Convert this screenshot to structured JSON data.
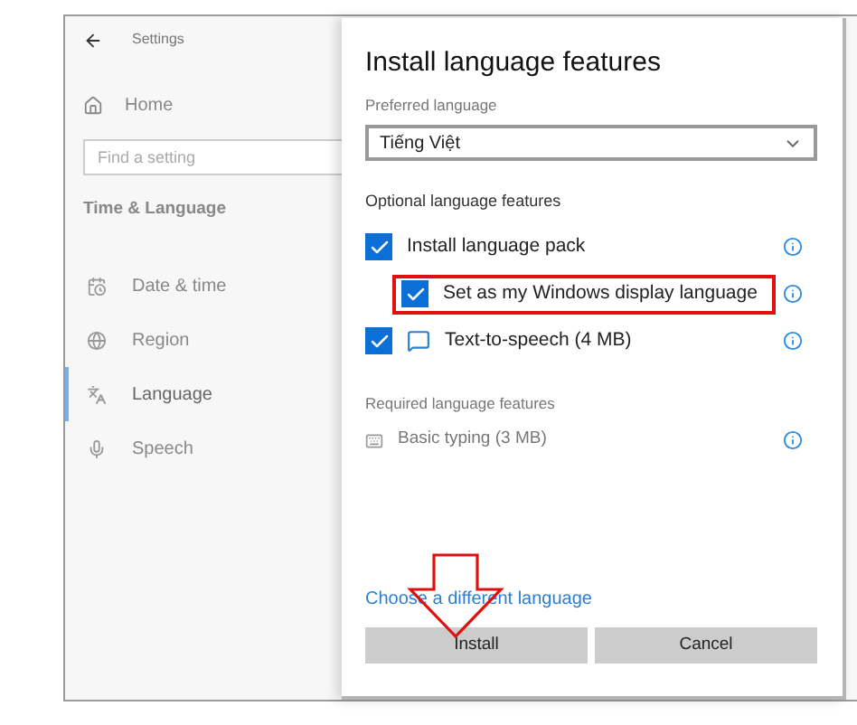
{
  "window": {
    "title": "Settings"
  },
  "sidebar": {
    "home": "Home",
    "search": {
      "placeholder": "Find a setting"
    },
    "section": "Time & Language",
    "items": [
      {
        "label": "Date & time",
        "selected": false
      },
      {
        "label": "Region",
        "selected": false
      },
      {
        "label": "Language",
        "selected": true
      },
      {
        "label": "Speech",
        "selected": false
      }
    ]
  },
  "dialog": {
    "title": "Install language features",
    "preferred_label": "Preferred language",
    "preferred_value": "Tiếng Việt",
    "optional_label": "Optional language features",
    "optional": [
      {
        "label": "Install language pack",
        "checked": true,
        "highlighted": false,
        "children": [
          {
            "label": "Set as my Windows display language",
            "checked": true,
            "highlighted": true
          }
        ]
      },
      {
        "label": "Text-to-speech (4 MB)",
        "checked": true,
        "highlighted": false
      }
    ],
    "required_label": "Required language features",
    "required": [
      {
        "label": "Basic typing (3 MB)"
      }
    ],
    "link": "Choose a different language",
    "buttons": [
      {
        "label": "Install"
      },
      {
        "label": "Cancel"
      }
    ],
    "pointer_arrow": true
  }
}
